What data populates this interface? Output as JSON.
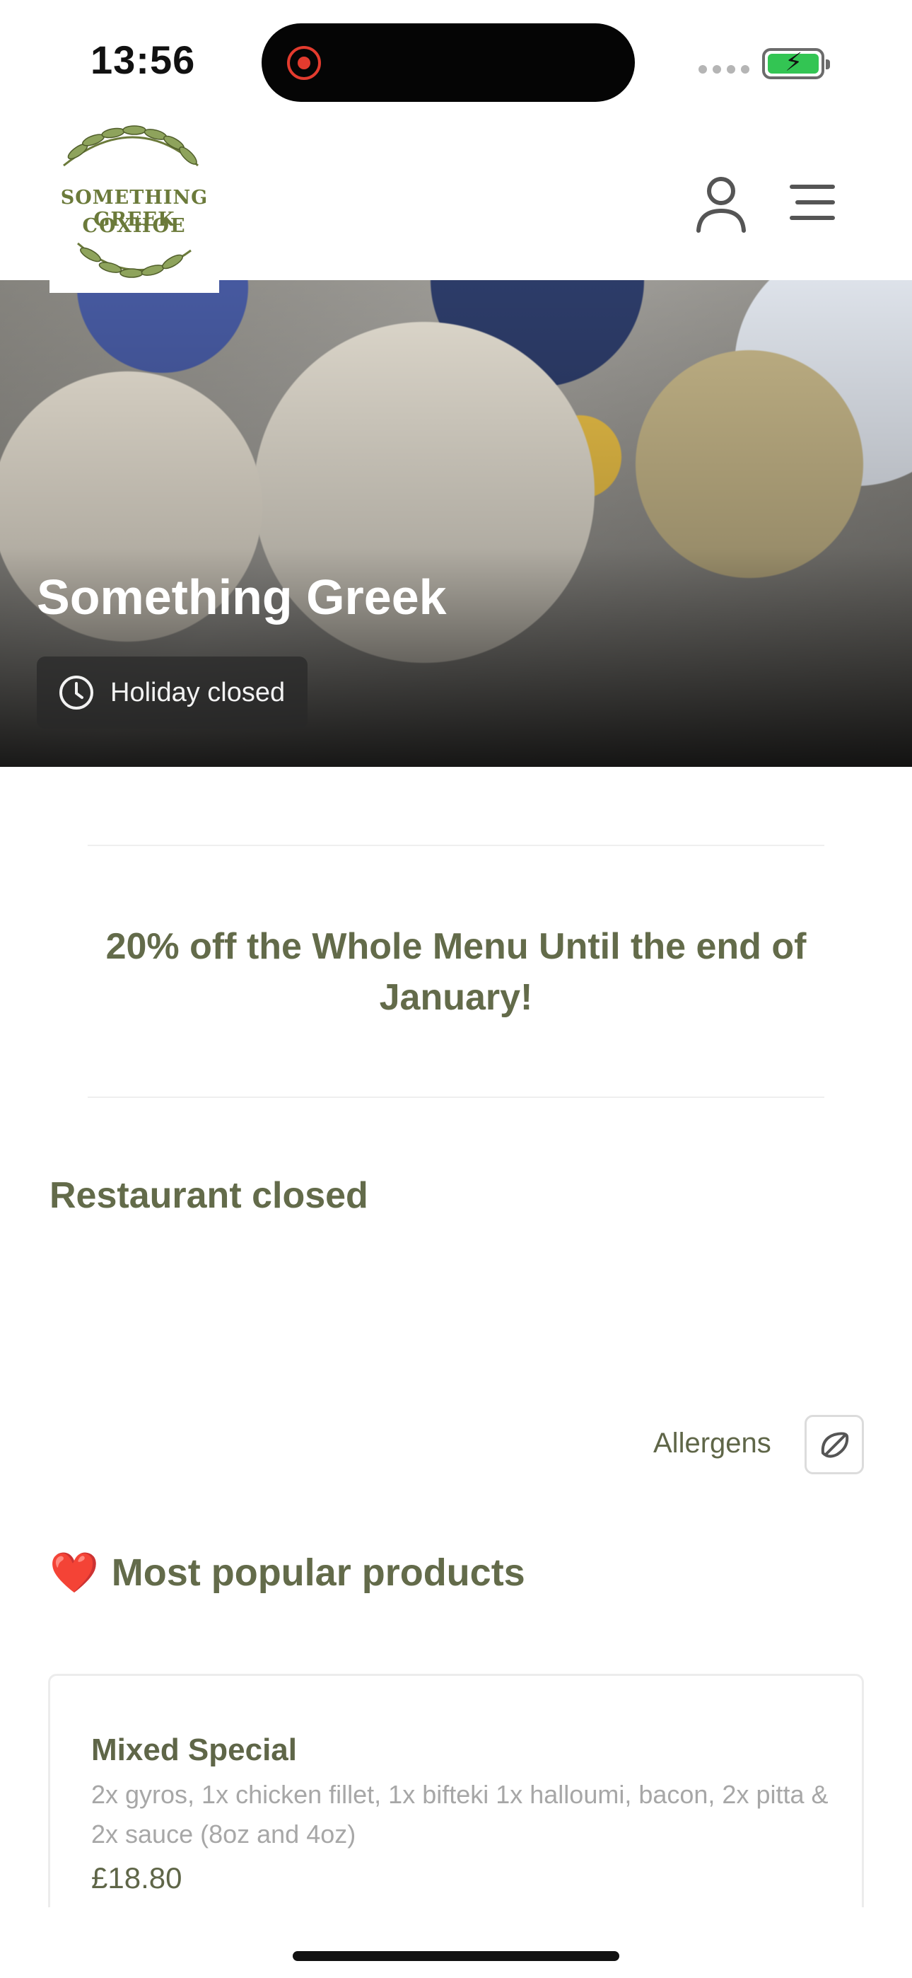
{
  "status_bar": {
    "time": "13:56"
  },
  "header": {
    "logo_line1": "SOMETHING GREEK",
    "logo_line2": "COXHOE",
    "icons": [
      "user-icon",
      "hamburger-menu-icon"
    ]
  },
  "hero": {
    "title": "Something Greek",
    "status": "Holiday closed",
    "status_icon": "clock-icon"
  },
  "promo": {
    "text": "20% off the Whole Menu Until the end of January!"
  },
  "restaurant_status": {
    "title": "Restaurant closed"
  },
  "allergens": {
    "label": "Allergens",
    "icon": "allergens-icon"
  },
  "popular": {
    "emoji": "❤️",
    "title": "Most popular products",
    "products": [
      {
        "name": "Mixed Special",
        "description": "2x gyros, 1x chicken fillet, 1x bifteki 1x halloumi, bacon, 2x pitta & 2x sauce (8oz and 4oz)",
        "price": "£18.80"
      }
    ]
  },
  "colors": {
    "brand_olive": "#636b4a",
    "heart_red": "#e02121",
    "battery_green": "#33c553"
  }
}
